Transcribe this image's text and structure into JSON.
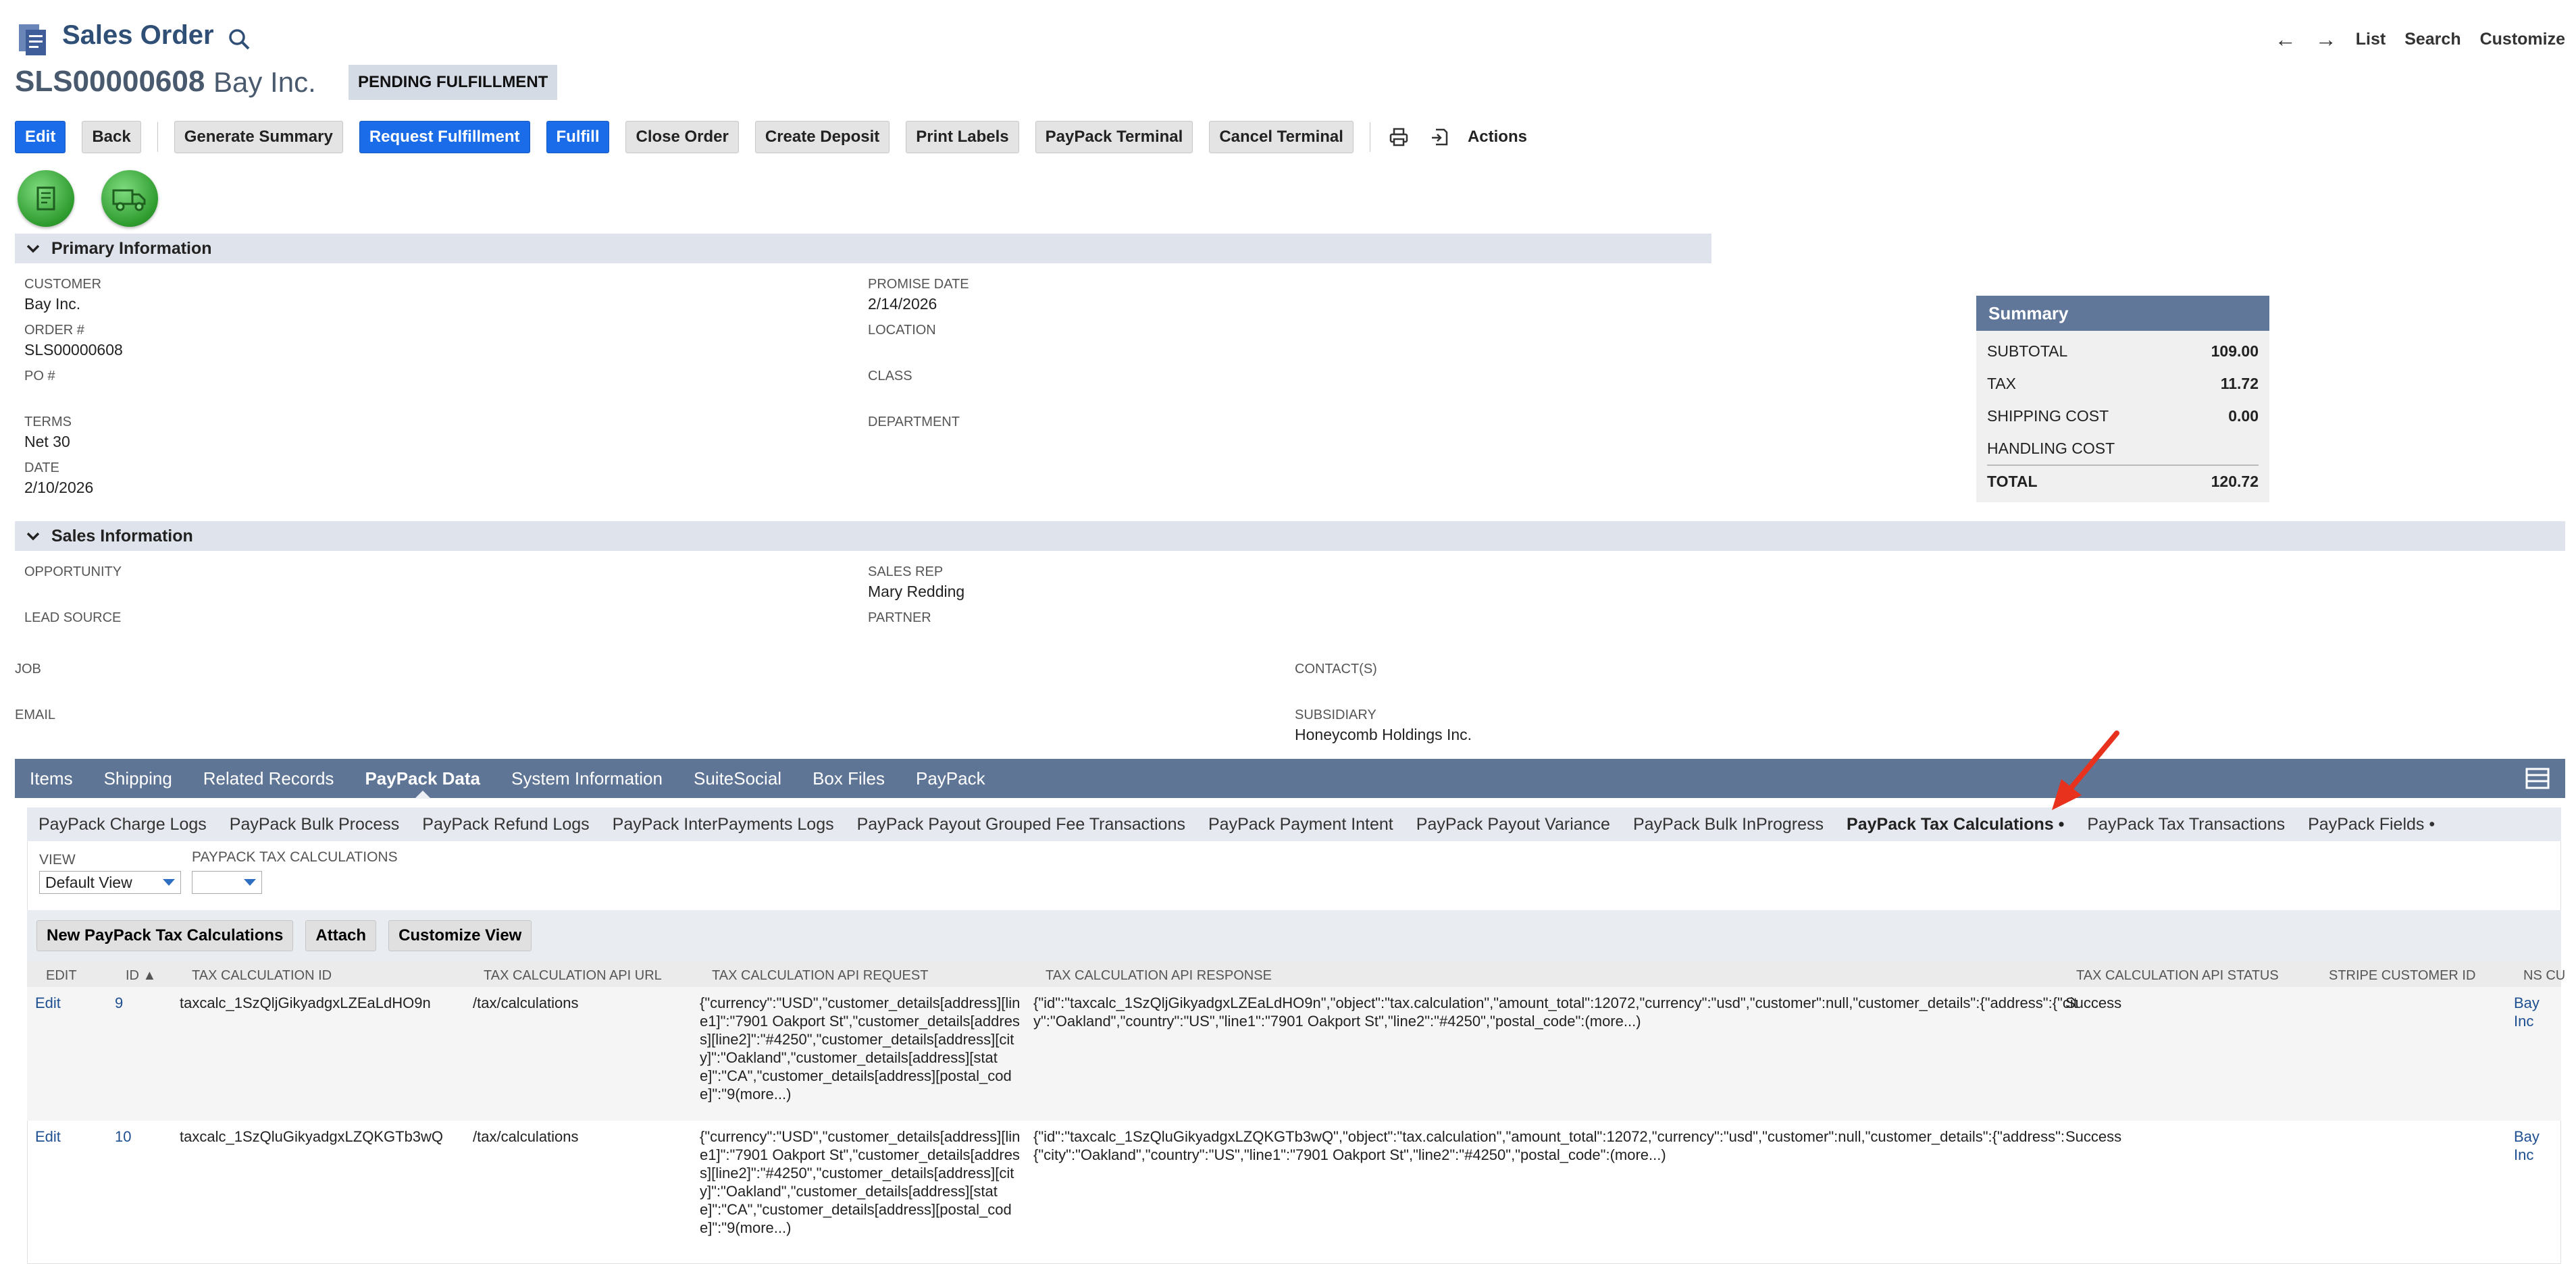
{
  "header": {
    "title": "Sales Order",
    "record_number": "SLS00000608",
    "company": "Bay Inc.",
    "status": "PENDING FULFILLMENT",
    "nav": {
      "list": "List",
      "search": "Search",
      "customize": "Customize",
      "back_arrow": "←",
      "forward_arrow": "→"
    }
  },
  "buttons": {
    "edit": "Edit",
    "back": "Back",
    "generate_summary": "Generate Summary",
    "request_fulfillment": "Request Fulfillment",
    "fulfill": "Fulfill",
    "close_order": "Close Order",
    "create_deposit": "Create Deposit",
    "print_labels": "Print Labels",
    "paypack_terminal": "PayPack Terminal",
    "cancel_terminal": "Cancel Terminal",
    "actions": "Actions"
  },
  "primary": {
    "title": "Primary Information",
    "customer_label": "CUSTOMER",
    "customer_value": "Bay Inc.",
    "order_label": "ORDER #",
    "order_value": "SLS00000608",
    "po_label": "PO #",
    "terms_label": "TERMS",
    "terms_value": "Net 30",
    "date_label": "DATE",
    "date_value": "2/10/2026",
    "promise_label": "PROMISE DATE",
    "promise_value": "2/14/2026",
    "location_label": "LOCATION",
    "class_label": "CLASS",
    "department_label": "DEPARTMENT"
  },
  "summary": {
    "title": "Summary",
    "rows": [
      {
        "label": "SUBTOTAL",
        "value": "109.00"
      },
      {
        "label": "TAX",
        "value": "11.72"
      },
      {
        "label": "SHIPPING COST",
        "value": "0.00"
      },
      {
        "label": "HANDLING COST",
        "value": ""
      }
    ],
    "total_label": "TOTAL",
    "total_value": "120.72"
  },
  "sales": {
    "title": "Sales Information",
    "opportunity_label": "OPPORTUNITY",
    "lead_source_label": "LEAD SOURCE",
    "sales_rep_label": "SALES REP",
    "sales_rep_value": "Mary Redding",
    "partner_label": "PARTNER",
    "job_label": "JOB",
    "email_label": "EMAIL",
    "contacts_label": "CONTACT(S)",
    "subsidiary_label": "SUBSIDIARY",
    "subsidiary_value": "Honeycomb Holdings Inc."
  },
  "tabs": [
    "Items",
    "Shipping",
    "Related Records",
    "PayPack Data",
    "System Information",
    "SuiteSocial",
    "Box Files",
    "PayPack"
  ],
  "subtabs": [
    "PayPack Charge Logs",
    "PayPack Bulk Process",
    "PayPack Refund Logs",
    "PayPack InterPayments Logs",
    "PayPack Payout Grouped Fee Transactions",
    "PayPack Payment Intent",
    "PayPack Payout Variance",
    "PayPack Bulk InProgress",
    "PayPack Tax Calculations •",
    "PayPack Tax Transactions",
    "PayPack Fields •"
  ],
  "list": {
    "view_label": "VIEW",
    "view_value": "Default View",
    "filter_label": "PAYPACK TAX CALCULATIONS",
    "filter_value": "",
    "new_button": "New PayPack Tax Calculations",
    "attach_button": "Attach",
    "customize_button": "Customize View",
    "columns": [
      "EDIT",
      "ID ▲",
      "TAX CALCULATION ID",
      "TAX CALCULATION API URL",
      "TAX CALCULATION API REQUEST",
      "TAX CALCULATION API RESPONSE",
      "TAX CALCULATION API STATUS",
      "STRIPE CUSTOMER ID",
      "NS CU"
    ],
    "rows": [
      {
        "edit": "Edit",
        "id": "9",
        "calc_id": "taxcalc_1SzQljGikyadgxLZEaLdHO9n",
        "url": "/tax/calculations",
        "request": "{\"currency\":\"USD\",\"customer_details[address][line1]\":\"7901 Oakport St\",\"customer_details[address][line2]\":\"#4250\",\"customer_details[address][city]\":\"Oakland\",\"customer_details[address][state]\":\"CA\",\"customer_details[address][postal_code]\":\"9(more...)",
        "response": "{\"id\":\"taxcalc_1SzQljGikyadgxLZEaLdHO9n\",\"object\":\"tax.calculation\",\"amount_total\":12072,\"currency\":\"usd\",\"customer\":null,\"customer_details\":{\"address\":{\"city\":\"Oakland\",\"country\":\"US\",\"line1\":\"7901 Oakport St\",\"line2\":\"#4250\",\"postal_code\":(more...)",
        "status": "Success",
        "ns_customer": "Bay Inc"
      },
      {
        "edit": "Edit",
        "id": "10",
        "calc_id": "taxcalc_1SzQluGikyadgxLZQKGTb3wQ",
        "url": "/tax/calculations",
        "request": "{\"currency\":\"USD\",\"customer_details[address][line1]\":\"7901 Oakport St\",\"customer_details[address][line2]\":\"#4250\",\"customer_details[address][city]\":\"Oakland\",\"customer_details[address][state]\":\"CA\",\"customer_details[address][postal_code]\":\"9(more...)",
        "response": "{\"id\":\"taxcalc_1SzQluGikyadgxLZQKGTb3wQ\",\"object\":\"tax.calculation\",\"amount_total\":12072,\"currency\":\"usd\",\"customer\":null,\"customer_details\":{\"address\":{\"city\":\"Oakland\",\"country\":\"US\",\"line1\":\"7901 Oakport St\",\"line2\":\"#4250\",\"postal_code\":(more...)",
        "status": "Success",
        "ns_customer": "Bay Inc"
      }
    ]
  },
  "colors": {
    "primary_button": "#1a6ce8",
    "tabbar": "#5f7595",
    "summary_head": "#607799",
    "section": "#dfe3eb",
    "annotation_arrow": "#e8321e"
  },
  "icons": [
    "document-icon",
    "search-icon",
    "print-icon",
    "export-icon",
    "invoice-icon",
    "truck-icon",
    "chevron-down-icon",
    "grid-icon",
    "red-annotation-arrow"
  ]
}
